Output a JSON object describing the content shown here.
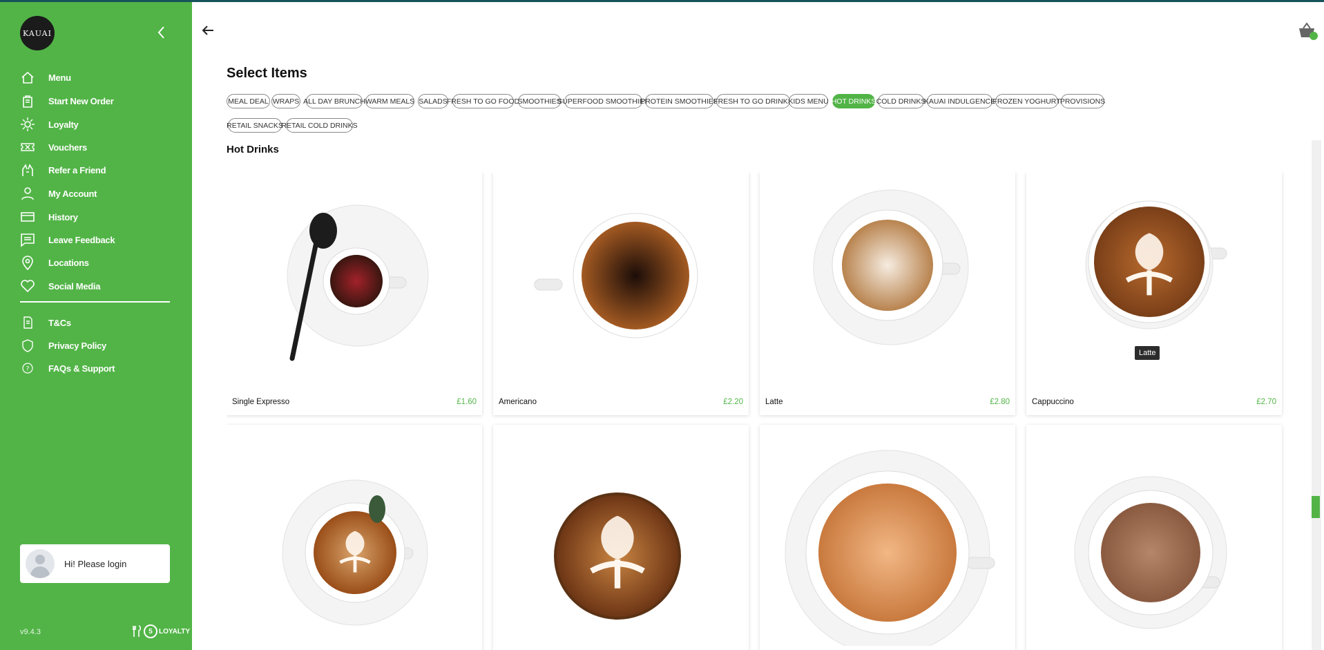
{
  "app": {
    "logo_text": "KAUAI",
    "version": "v9.4.3",
    "powered_by": "LOYALTY",
    "powered_num": "5"
  },
  "colors": {
    "brand_green": "#52b447",
    "top_line": "#16535a"
  },
  "sidebar": {
    "items": [
      {
        "label": "Menu",
        "icon": "home-icon"
      },
      {
        "label": "Start New Order",
        "icon": "order-bag-icon"
      },
      {
        "label": "Loyalty",
        "icon": "sun-icon"
      },
      {
        "label": "Vouchers",
        "icon": "ticket-icon"
      },
      {
        "label": "Refer a Friend",
        "icon": "hands-icon"
      },
      {
        "label": "My Account",
        "icon": "user-icon"
      },
      {
        "label": "History",
        "icon": "history-card-icon"
      },
      {
        "label": "Leave Feedback",
        "icon": "feedback-icon"
      },
      {
        "label": "Locations",
        "icon": "location-pin-icon"
      },
      {
        "label": "Social Media",
        "icon": "heart-icon"
      }
    ],
    "secondary": [
      {
        "label": "T&Cs",
        "icon": "document-icon"
      },
      {
        "label": "Privacy Policy",
        "icon": "shield-icon"
      },
      {
        "label": "FAQs & Support",
        "icon": "help-icon"
      }
    ],
    "login_text": "Hi! Please login"
  },
  "main": {
    "page_title": "Select Items",
    "section_title": "Hot Drinks",
    "basket_count": "0",
    "categories": [
      {
        "label": "MEAL DEAL",
        "active": false
      },
      {
        "label": "WRAPS",
        "active": false
      },
      {
        "label": "ALL DAY BRUNCH",
        "active": false
      },
      {
        "label": "WARM MEALS",
        "active": false
      },
      {
        "label": "SALADS",
        "active": false
      },
      {
        "label": "FRESH TO GO FOOD",
        "active": false
      },
      {
        "label": "SMOOTHIES",
        "active": false
      },
      {
        "label": "SUPERFOOD SMOOTHIES",
        "active": false
      },
      {
        "label": "PROTEIN SMOOTHIES",
        "active": false
      },
      {
        "label": "FRESH TO GO DRINKS",
        "active": false
      },
      {
        "label": "KIDS MENU",
        "active": false
      },
      {
        "label": "HOT DRINKS",
        "active": true
      },
      {
        "label": "COLD DRINKS",
        "active": false
      },
      {
        "label": "KAUAI INDULGENCE",
        "active": false
      },
      {
        "label": "FROZEN YOGHURT",
        "active": false
      },
      {
        "label": "PROVISIONS",
        "active": false
      },
      {
        "label": "RETAIL SNACKS",
        "active": false
      },
      {
        "label": "RETAIL COLD DRINKS",
        "active": false
      }
    ],
    "products": [
      {
        "name": "Single Expresso",
        "price": "£1.60",
        "drink": "espresso"
      },
      {
        "name": "Americano",
        "price": "£2.20",
        "drink": "americano"
      },
      {
        "name": "Latte",
        "price": "£2.80",
        "drink": "latte"
      },
      {
        "name": "Cappuccino",
        "price": "£2.70",
        "drink": "cappuccino"
      },
      {
        "name": "",
        "price": "",
        "drink": "flatwhite"
      },
      {
        "name": "",
        "price": "",
        "drink": "artcup"
      },
      {
        "name": "",
        "price": "",
        "drink": "bigcup"
      },
      {
        "name": "",
        "price": "",
        "drink": "chocolate"
      }
    ],
    "tooltip": "Latte"
  }
}
